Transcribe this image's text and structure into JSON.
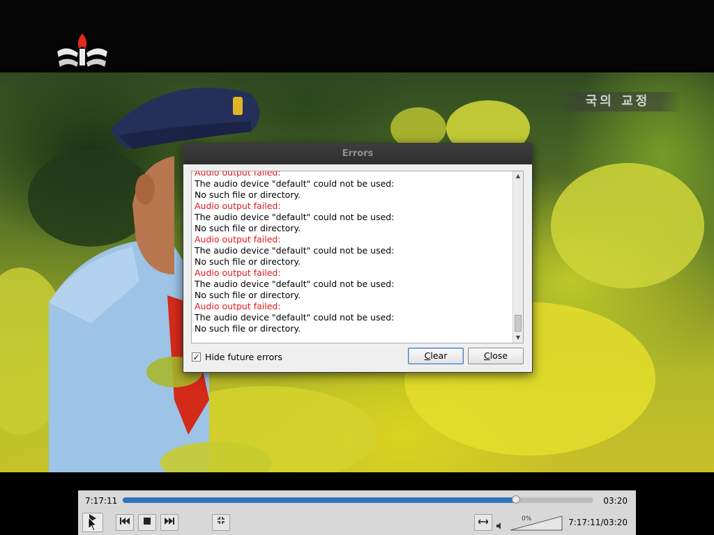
{
  "dialog": {
    "title": "Errors",
    "log": [
      {
        "text": "Audio output failed:",
        "type": "error"
      },
      {
        "text": "The audio device \"default\" could not be used:",
        "type": "message"
      },
      {
        "text": "No such file or directory.",
        "type": "message"
      },
      {
        "text": "Audio output failed:",
        "type": "error"
      },
      {
        "text": "The audio device \"default\" could not be used:",
        "type": "message"
      },
      {
        "text": "No such file or directory.",
        "type": "message"
      },
      {
        "text": "Audio output failed:",
        "type": "error"
      },
      {
        "text": "The audio device \"default\" could not be used:",
        "type": "message"
      },
      {
        "text": "No such file or directory.",
        "type": "message"
      },
      {
        "text": "Audio output failed:",
        "type": "error"
      },
      {
        "text": "The audio device \"default\" could not be used:",
        "type": "message"
      },
      {
        "text": "No such file or directory.",
        "type": "message"
      },
      {
        "text": "Audio output failed:",
        "type": "error"
      },
      {
        "text": "The audio device \"default\" could not be used:",
        "type": "message"
      },
      {
        "text": "No such file or directory.",
        "type": "message"
      }
    ],
    "hide_future_errors_label": "Hide future errors",
    "hide_future_errors_checked": true,
    "clear_button": {
      "mnemonic": "C",
      "rest": "lear"
    },
    "close_button": {
      "mnemonic": "C",
      "rest": "lose"
    },
    "colors": {
      "error_text": "#e01818",
      "titlebar": "#333333"
    }
  },
  "player": {
    "elapsed": "7:17:11",
    "duration": "03:20",
    "time_display": "7:17:11/03:20",
    "seek_fraction": 0.835,
    "volume_label": "0%",
    "volume_fraction": 0.0,
    "controls": {
      "play": "play-icon",
      "previous": "skip-previous-icon",
      "stop": "stop-icon",
      "next": "skip-next-icon",
      "fullscreen": "fullscreen-icon",
      "extended_settings": "extended-settings-icon",
      "volume": "speaker-icon"
    },
    "colors": {
      "seek_fill": "#2f74b8",
      "controller_bg": "#d8d8d8"
    }
  },
  "video": {
    "watermark": "국의 교정",
    "channel_logo": "torch-emblem-icon"
  }
}
